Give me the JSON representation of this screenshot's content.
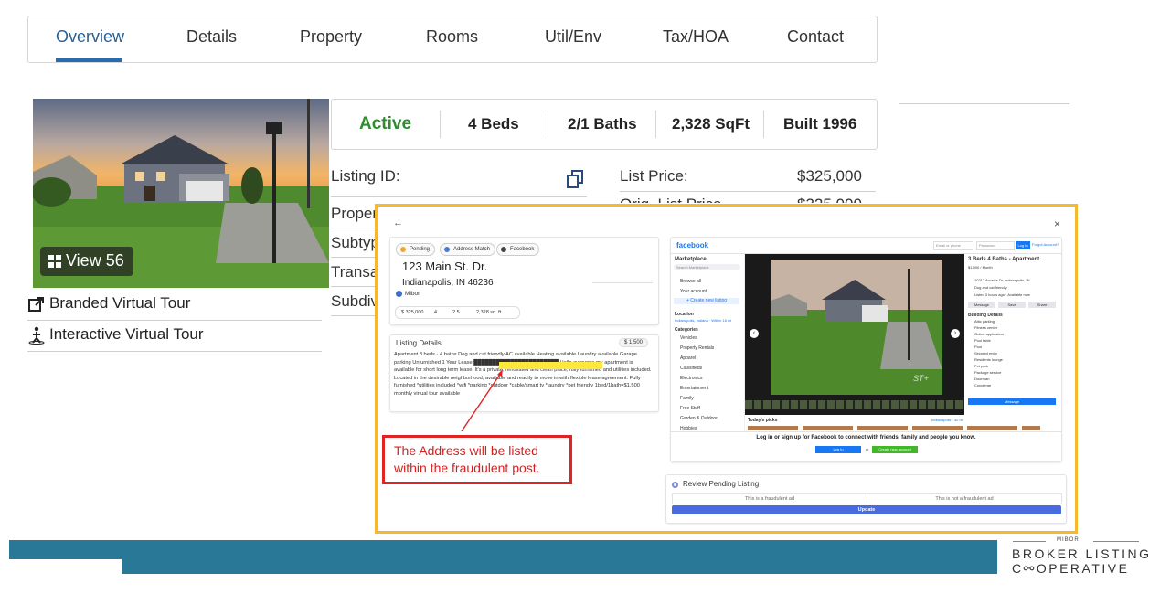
{
  "tabs": [
    "Overview",
    "Details",
    "Property",
    "Rooms",
    "Util/Env",
    "Tax/HOA",
    "Contact"
  ],
  "photo": {
    "view_label": "View 56"
  },
  "links": {
    "branded": "Branded Virtual Tour",
    "interactive": "Interactive Virtual Tour"
  },
  "summary": {
    "status": "Active",
    "beds": "4 Beds",
    "baths": "2/1 Baths",
    "sqft": "2,328 SqFt",
    "built": "Built 1996"
  },
  "fields": {
    "listing_id_label": "Listing ID:",
    "list_price_label": "List Price:",
    "list_price_value": "$325,000",
    "orig_list_price_label": "Orig. List Price",
    "orig_list_price_value": "$325,000",
    "property_label": "Proper",
    "subtype_label": "Subtyp",
    "transaction_label": "Transa",
    "subdivision_label": "Subdiv"
  },
  "popup": {
    "pills": [
      "Pending",
      "Address Match",
      "Facebook"
    ],
    "address_line1": "123 Main St. Dr.",
    "address_line2": "Indianapolis, IN 46236",
    "source": "Mibor",
    "stats": [
      "$ 325,000",
      "4",
      "2.5",
      "2,328 sq. ft."
    ],
    "listing_details_title": "Listing Details",
    "listing_details_price": "$ 1,500",
    "description": "Apartment 3 beds · 4 baths Dog and cat friendly AC available Heating available Laundry available Garage parking Unfurnished 1 Year Lease ███████████████████████ Hello everyone my apartment is available for short long term lease. It's a private, renovated and clean place, fully furnished and utilities included. Located in the desirable neighborhood, available and readily to move in with flexible lease agreement. Fully furnished *utilities included *wifi *parking *outdoor *cable/smart tv *laundry *pet friendly 1bed/1bath=$1,500 monthly virtual tour available",
    "review_title": "Review Pending Listing",
    "review_options": [
      "This is a fraudulent ad",
      "This is not a fraudulent ad"
    ],
    "update_label": "Update"
  },
  "facebook": {
    "brand": "facebook",
    "email_placeholder": "Email or phone",
    "password_placeholder": "Password",
    "login_label": "Log In",
    "forgot_label": "Forgot Account?",
    "marketplace": "Marketplace",
    "search_placeholder": "Search Marketplace",
    "sidebar": [
      "Browse all",
      "Your account"
    ],
    "create_listing": "+ Create new listing",
    "location_title": "Location",
    "location_value": "Indianapolis, Indiana · Within 16 mi",
    "categories_title": "Categories",
    "categories": [
      "Vehicles",
      "Property Rentals",
      "Apparel",
      "Classifieds",
      "Electronics",
      "Entertainment",
      "Family",
      "Free Stuff",
      "Garden & Outdoor",
      "Hobbies"
    ],
    "listing_title": "3 Beds 4 Baths - Apartment",
    "listing_price": "$1,500 / Month",
    "listing_info": [
      "10212 Arcadia Dr, Indianapolis, IN",
      "Dog and cat friendly",
      "Listed 3 hours ago · Available now"
    ],
    "buttons": [
      "Message",
      "Save",
      "Share"
    ],
    "building_title": "Building Details",
    "building": [
      "Attic parking",
      "Fitness center",
      "Online application",
      "Pool table",
      "Pool",
      "Secured entry",
      "Residents lounge",
      "Pet park",
      "Package service",
      "Doorman",
      "Concierge"
    ],
    "message_label": "Message",
    "todays_picks": "Today's picks",
    "todays_picks_loc": "Indianapolis · 40 mi",
    "login_prompt": "Log in or sign up for Facebook to connect with friends, family and people you know.",
    "login_btn": "Log In",
    "or": "or",
    "create_btn": "Create new account",
    "watermark": "ST+"
  },
  "annotation": "The Address will be listed within the fraudulent post.",
  "footer": {
    "org": "MIBOR",
    "line1": "BROKER LISTING",
    "line2": "C⚯OPERATIVE"
  }
}
